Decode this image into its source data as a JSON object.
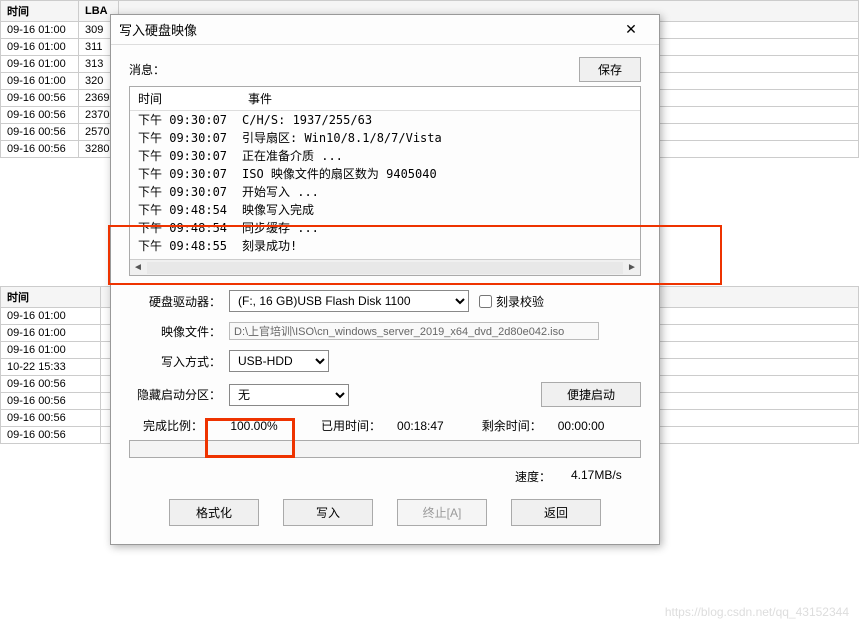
{
  "bg": {
    "header1": "时间",
    "header2": "LBA",
    "rows1": [
      {
        "t": "09-16 01:00",
        "lba": "309"
      },
      {
        "t": "09-16 01:00",
        "lba": "311"
      },
      {
        "t": "09-16 01:00",
        "lba": "313"
      },
      {
        "t": "09-16 01:00",
        "lba": "320"
      },
      {
        "t": "09-16 00:56",
        "lba": "2369"
      },
      {
        "t": "09-16 00:56",
        "lba": "2370"
      },
      {
        "t": "09-16 00:56",
        "lba": "2570"
      },
      {
        "t": "09-16 00:56",
        "lba": "3280"
      }
    ],
    "header3": "时间",
    "rows2": [
      {
        "t": "09-16 01:00"
      },
      {
        "t": "09-16 01:00"
      },
      {
        "t": "09-16 01:00"
      },
      {
        "t": "10-22 15:33"
      },
      {
        "t": "09-16 00:56"
      },
      {
        "t": "09-16 00:56"
      },
      {
        "t": "09-16 00:56"
      },
      {
        "t": "09-16 00:56"
      }
    ]
  },
  "dialog": {
    "title": "写入硬盘映像",
    "close": "✕",
    "msg_label": "消息：",
    "save_btn": "保存",
    "log_header_time": "时间",
    "log_header_event": "事件",
    "log": [
      {
        "time": "下午 09:30:07",
        "event": "C/H/S: 1937/255/63"
      },
      {
        "time": "下午 09:30:07",
        "event": "引导扇区: Win10/8.1/8/7/Vista"
      },
      {
        "time": "下午 09:30:07",
        "event": "正在准备介质 ..."
      },
      {
        "time": "下午 09:30:07",
        "event": "ISO 映像文件的扇区数为 9405040"
      },
      {
        "time": "下午 09:30:07",
        "event": "开始写入 ..."
      },
      {
        "time": "下午 09:48:54",
        "event": "映像写入完成"
      },
      {
        "time": "下午 09:48:54",
        "event": "同步缓存 ..."
      },
      {
        "time": "下午 09:48:55",
        "event": "刻录成功!"
      }
    ],
    "drive_label": "硬盘驱动器：",
    "drive_value": "(F:, 16 GB)USB     Flash Disk     1100",
    "verify_label": "刻录校验",
    "image_label": "映像文件：",
    "image_value": "D:\\上官培训\\ISO\\cn_windows_server_2019_x64_dvd_2d80e042.iso",
    "method_label": "写入方式：",
    "method_value": "USB-HDD",
    "hidden_label": "隐藏启动分区：",
    "hidden_value": "无",
    "quick_boot": "便捷启动",
    "complete_label": "完成比例：",
    "complete_value": "100.00%",
    "elapsed_label": "已用时间：",
    "elapsed_value": "00:18:47",
    "remain_label": "剩余时间：",
    "remain_value": "00:00:00",
    "speed_label": "速度：",
    "speed_value": "4.17MB/s",
    "format_btn": "格式化",
    "write_btn": "写入",
    "abort_btn": "终止[A]",
    "return_btn": "返回"
  },
  "watermark": "https://blog.csdn.net/qq_43152344"
}
